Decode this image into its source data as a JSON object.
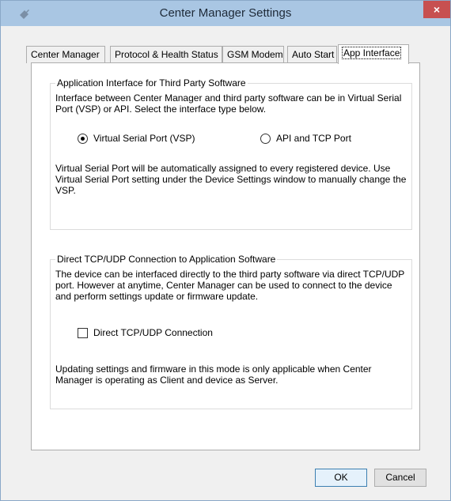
{
  "window": {
    "title": "Center Manager Settings",
    "close_glyph": "×"
  },
  "tabs": [
    {
      "label": "Center Manager"
    },
    {
      "label": "Protocol & Health Status"
    },
    {
      "label": "GSM Modem"
    },
    {
      "label": "Auto Start"
    },
    {
      "label": "App Interface",
      "active": true
    }
  ],
  "app_interface_group": {
    "legend": "Application Interface for Third Party Software",
    "description": "Interface between Center Manager and third party software can be in Virtual Serial Port (VSP) or API. Select the interface type below.",
    "radio_vsp_label": "Virtual Serial Port (VSP)",
    "radio_vsp_checked": true,
    "radio_api_label": "API and TCP Port",
    "radio_api_checked": false,
    "note": "Virtual Serial Port will be automatically assigned to every registered device. Use Virtual Serial Port setting under the Device Settings window to manually change the VSP."
  },
  "direct_group": {
    "legend": "Direct TCP/UDP Connection to Application Software",
    "description": "The device can be interfaced directly to the third party software via direct TCP/UDP port. However at anytime, Center Manager can be used to connect to the device and perform settings update or firmware update.",
    "checkbox_label": "Direct TCP/UDP Connection",
    "checkbox_checked": false,
    "note": "Updating settings and firmware in this mode is only applicable when Center Manager is operating as Client and device as Server."
  },
  "buttons": {
    "ok": "OK",
    "cancel": "Cancel"
  }
}
